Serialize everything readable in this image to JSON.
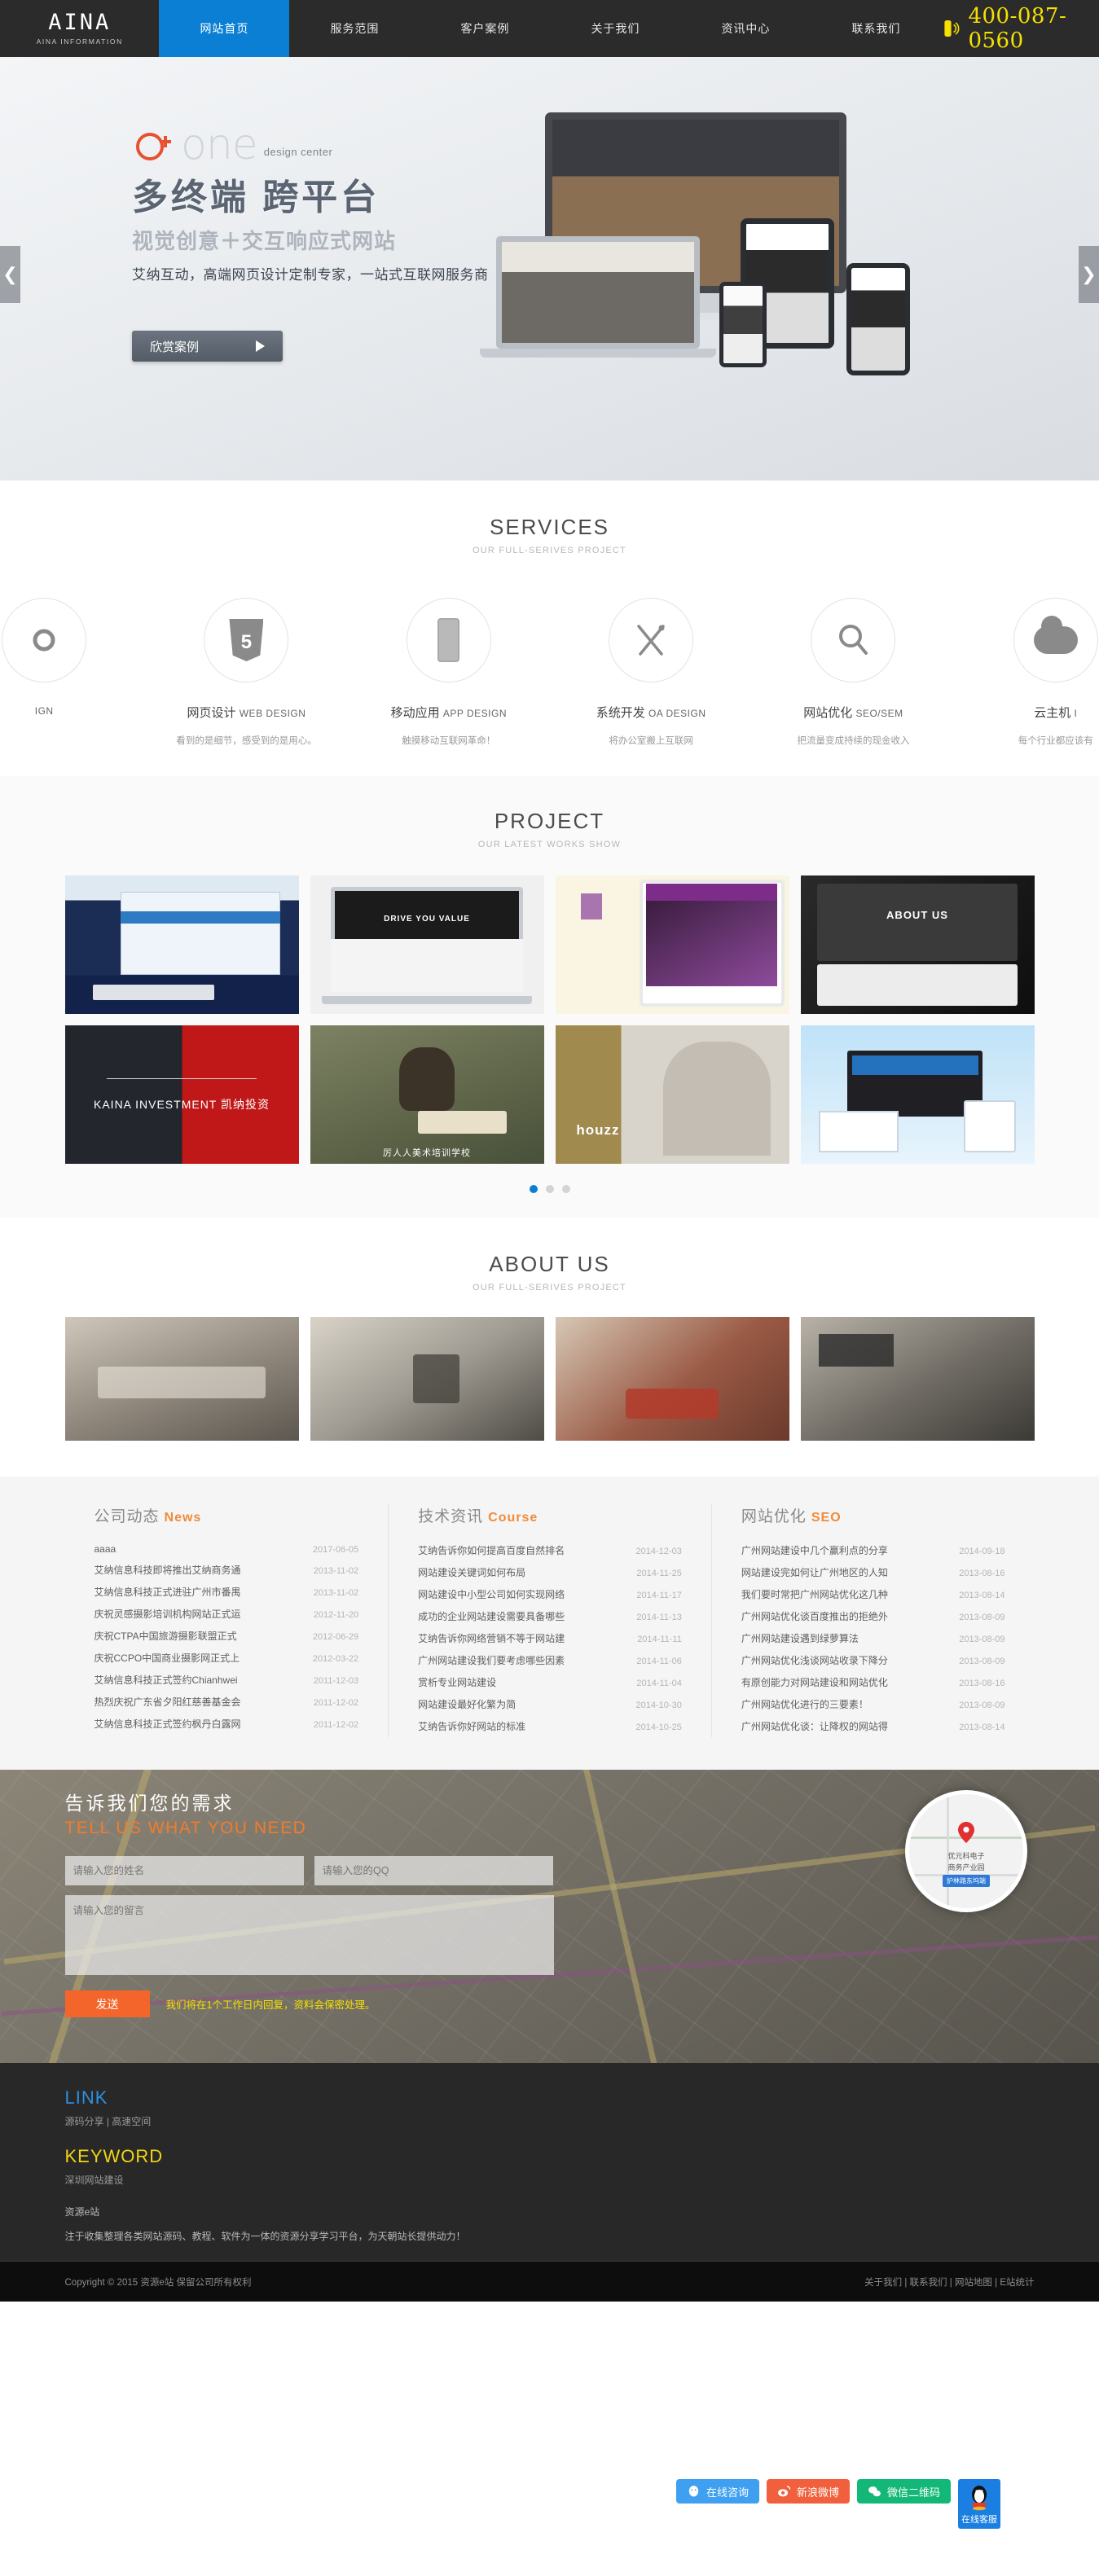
{
  "header": {
    "logo_mark": "AINA",
    "logo_sub": "AINA INFORMATION",
    "nav": [
      {
        "label": "网站首页",
        "active": true
      },
      {
        "label": "服务范围",
        "active": false
      },
      {
        "label": "客户案例",
        "active": false
      },
      {
        "label": "关于我们",
        "active": false
      },
      {
        "label": "资讯中心",
        "active": false
      },
      {
        "label": "联系我们",
        "active": false
      }
    ],
    "phone": "400-087-0560",
    "phone_icon": "phone-icon",
    "accent_blue": "#0b7fd4",
    "phone_yellow": "#f5e000"
  },
  "hero": {
    "brand_mark": "o+",
    "brand_word": "one",
    "brand_tag": "design center",
    "headline": "多终端 跨平台",
    "subline": "视觉创意＋交互响应式网站",
    "desc": "艾纳互动，高端网页设计定制专家，一站式互联网服务商",
    "cta": "欣赏案例",
    "prev_icon": "chevron-left-icon",
    "next_icon": "chevron-right-icon"
  },
  "services": {
    "title": "SERVICES",
    "subtitle": "OUR FULL-SERIVES PROJECT",
    "items": [
      {
        "icon": "gear-icon",
        "name": "",
        "en": "IGN",
        "desc": "",
        "partial": true
      },
      {
        "icon": "html5-icon",
        "name": "网页设计",
        "en": "WEB DESIGN",
        "desc": "看到的是细节，感受到的是用心。"
      },
      {
        "icon": "mobile-icon",
        "name": "移动应用",
        "en": "APP DESIGN",
        "desc": "触摸移动互联网革命！"
      },
      {
        "icon": "tools-icon",
        "name": "系统开发",
        "en": "OA DESIGN",
        "desc": "将办公室搬上互联网"
      },
      {
        "icon": "magnifier-icon",
        "name": "网站优化",
        "en": "SEO/SEM",
        "desc": "把流量变成持续的现金收入"
      },
      {
        "icon": "cloud-icon",
        "name": "云主机",
        "en": "I",
        "desc": "每个行业都应该有",
        "partial": true
      }
    ]
  },
  "project": {
    "title": "PROJECT",
    "subtitle": "OUR LATEST WORKS SHOW",
    "items": [
      {
        "caption": "",
        "kind": "blue-site-mockup"
      },
      {
        "caption": "DRIVE YOU VALUE",
        "kind": "laptop-dark-mockup"
      },
      {
        "caption": "",
        "kind": "purple-tablet-mockup"
      },
      {
        "caption": "ABOUT US",
        "kind": "dark-tablet-mockup"
      },
      {
        "caption": "KAINA INVESTMENT 凯纳投资",
        "kind": "split-red-dark"
      },
      {
        "caption": "厉人人美术培训学校",
        "kind": "stilllife-painting"
      },
      {
        "caption": "houzz",
        "kind": "office-photo"
      },
      {
        "caption": "",
        "kind": "responsive-devices"
      }
    ],
    "dots": [
      true,
      false,
      false
    ]
  },
  "about": {
    "title": "ABOUT US",
    "subtitle": "OUR FULL-SERIVES PROJECT",
    "photos": [
      {
        "kind": "meeting-room"
      },
      {
        "kind": "office-desk"
      },
      {
        "kind": "lounge-red-sofa"
      },
      {
        "kind": "conference-hall"
      }
    ]
  },
  "news": {
    "columns": [
      {
        "title": "公司动态",
        "tag": "News",
        "items": [
          {
            "text": "aaaa",
            "date": "2017-06-05"
          },
          {
            "text": "艾纳信息科技即将推出艾纳商务通",
            "date": "2013-11-02"
          },
          {
            "text": "艾纳信息科技正式进驻广州市番禺",
            "date": "2013-11-02"
          },
          {
            "text": "庆祝灵感摄影培训机构网站正式运",
            "date": "2012-11-20"
          },
          {
            "text": "庆祝CTPA中国旅游摄影联盟正式",
            "date": "2012-06-29"
          },
          {
            "text": "庆祝CCPO中国商业摄影网正式上",
            "date": "2012-03-22"
          },
          {
            "text": "艾纳信息科技正式签约Chianhwei",
            "date": "2011-12-03"
          },
          {
            "text": "热烈庆祝广东省夕阳红慈善基金会",
            "date": "2011-12-02"
          },
          {
            "text": "艾纳信息科技正式签约枫丹白露网",
            "date": "2011-12-02"
          }
        ]
      },
      {
        "title": "技术资讯",
        "tag": "Course",
        "items": [
          {
            "text": "艾纳告诉你如何提高百度自然排名",
            "date": "2014-12-03"
          },
          {
            "text": "网站建设关键词如何布局",
            "date": "2014-11-25"
          },
          {
            "text": "网站建设中小型公司如何实现网络",
            "date": "2014-11-17"
          },
          {
            "text": "成功的企业网站建设需要具备哪些",
            "date": "2014-11-13"
          },
          {
            "text": "艾纳告诉你网络营销不等于网站建",
            "date": "2014-11-11"
          },
          {
            "text": "广州网站建设我们要考虑哪些因素",
            "date": "2014-11-06"
          },
          {
            "text": "赏析专业网站建设",
            "date": "2014-11-04"
          },
          {
            "text": "网站建设最好化繁为简",
            "date": "2014-10-30"
          },
          {
            "text": "艾纳告诉你好网站的标准",
            "date": "2014-10-25"
          }
        ]
      },
      {
        "title": "网站优化",
        "tag": "SEO",
        "items": [
          {
            "text": "广州网站建设中几个赢利点的分享",
            "date": "2014-09-18"
          },
          {
            "text": "网站建设完如何让广州地区的人知",
            "date": "2013-08-16"
          },
          {
            "text": "我们要时常把广州网站优化这几种",
            "date": "2013-08-14"
          },
          {
            "text": "广州网站优化谈百度推出的拒绝外",
            "date": "2013-08-09"
          },
          {
            "text": "广州网站建设遇到绿萝算法",
            "date": "2013-08-09"
          },
          {
            "text": "广州网站优化浅谈网站收录下降分",
            "date": "2013-08-09"
          },
          {
            "text": "有原创能力对网站建设和网站优化",
            "date": "2013-08-16"
          },
          {
            "text": "广州网站优化进行的三要素！",
            "date": "2013-08-09"
          },
          {
            "text": "广州网站优化谈：让降权的网站得",
            "date": "2013-08-14"
          }
        ]
      }
    ]
  },
  "contact": {
    "title_cn": "告诉我们您的需求",
    "title_en": "TELL US WHAT YOU NEED",
    "name_placeholder": "请输入您的姓名",
    "qq_placeholder": "请输入您的QQ",
    "message_placeholder": "请输入您的留言",
    "send_label": "发送",
    "note": "我们将在1个工作日内回复，资料会保密处理。",
    "map_label": "优元科电子\n商务产业园",
    "map_tag": "护林路东坞端",
    "map_pin_icon": "map-pin-icon"
  },
  "footer": {
    "link_title": "LINK",
    "link_items": "源码分享 | 高速空间",
    "keyword_title": "KEYWORD",
    "keyword_items": "深圳网站建设",
    "site_name": "资源e站",
    "site_desc": "注于收集整理各类网站源码、教程、软件为一体的资源分享学习平台，为天朝站长提供动力！",
    "copyright": "Copyright © 2015 资源e站 保留公司所有权利",
    "links": [
      {
        "label": "关于我们"
      },
      {
        "label": "联系我们"
      },
      {
        "label": "网站地图"
      },
      {
        "label": "E站统计"
      }
    ],
    "link_color": "#2f8fe0",
    "keyword_color": "#f2d414"
  },
  "floatbar": {
    "buttons": [
      {
        "label": "在线咨询",
        "icon": "qq-penguin-icon",
        "color": "#3f9ff0"
      },
      {
        "label": "新浪微博",
        "icon": "weibo-eye-icon",
        "color": "#f0603c"
      },
      {
        "label": "微信二维码",
        "icon": "wechat-icon",
        "color": "#13b878"
      }
    ],
    "kefu_label": "在线客服",
    "kefu_icon": "qq-penguin-icon"
  }
}
